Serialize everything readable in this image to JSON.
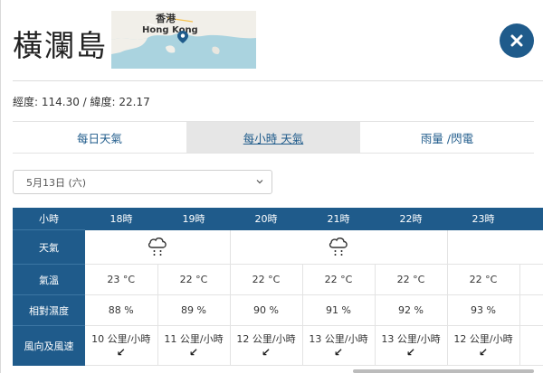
{
  "header": {
    "title": "橫瀾島",
    "map": {
      "label_cn": "香港",
      "label_en": "Hong Kong"
    }
  },
  "coords": "經度: 114.30 /  緯度: 22.17",
  "tabs": [
    {
      "label": "每日天氣",
      "active": false
    },
    {
      "label": "每小時 天氣",
      "active": true
    },
    {
      "label": "雨量 /閃電",
      "active": false
    }
  ],
  "date_select": {
    "value": "5月13日 (六)"
  },
  "table": {
    "head_label": "小時",
    "hours": [
      "18時",
      "19時",
      "20時",
      "21時",
      "22時",
      "23時",
      ""
    ],
    "row_labels": {
      "weather": "天氣",
      "temp": "氣溫",
      "humidity": "相對濕度",
      "wind": "風向及風速"
    },
    "weather_icons": [
      "rain-cloud",
      "rain-cloud",
      ""
    ],
    "temps": [
      "23 °C",
      "22 °C",
      "22 °C",
      "22 °C",
      "22 °C",
      "22 °C",
      ""
    ],
    "humidity": [
      "88 %",
      "89 %",
      "90 %",
      "91 %",
      "92 %",
      "93 %",
      ""
    ],
    "wind_speed": [
      "10 公里/小時",
      "11 公里/小時",
      "12 公里/小時",
      "13 公里/小時",
      "13 公里/小時",
      "12 公里/小時",
      "12"
    ],
    "wind_dir": [
      "↙",
      "↙",
      "↙",
      "↙",
      "↙",
      "↙",
      ""
    ]
  },
  "colors": {
    "accent": "#1f5b8b",
    "tab_active_bg": "#e6e6e6"
  }
}
